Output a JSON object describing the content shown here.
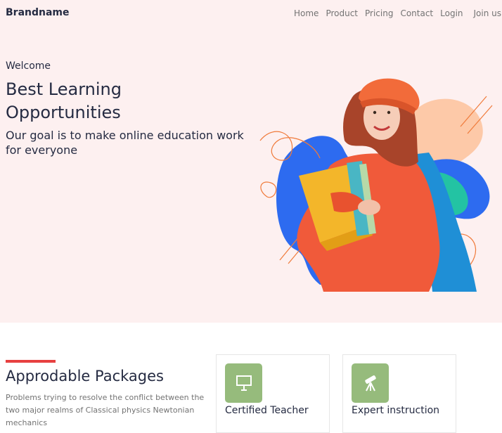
{
  "header": {
    "brand": "Brandname",
    "nav": [
      "Home",
      "Product",
      "Pricing",
      "Contact",
      "Login",
      "Join us"
    ]
  },
  "hero": {
    "welcome": "Welcome",
    "headline": "Best Learning Opportunities",
    "subheadline": "Our goal is to make online education work for everyone"
  },
  "packages": {
    "title": "Approdable Packages",
    "description": "Problems trying to resolve the conflict between the two major realms of Classical physics Newtonian mechanics",
    "cards": [
      {
        "title": "Certified Teacher",
        "icon": "presentation-board-icon"
      },
      {
        "title": "Expert instruction",
        "icon": "telescope-icon"
      }
    ]
  },
  "colors": {
    "hero_bg": "#FDF0F0",
    "accent_red": "#E74040",
    "icon_green": "#96BB7C",
    "text_dark": "#252B42",
    "text_muted": "#737373",
    "sweater_orange": "#F05A3A",
    "blob_blue": "#2D6BF0"
  }
}
